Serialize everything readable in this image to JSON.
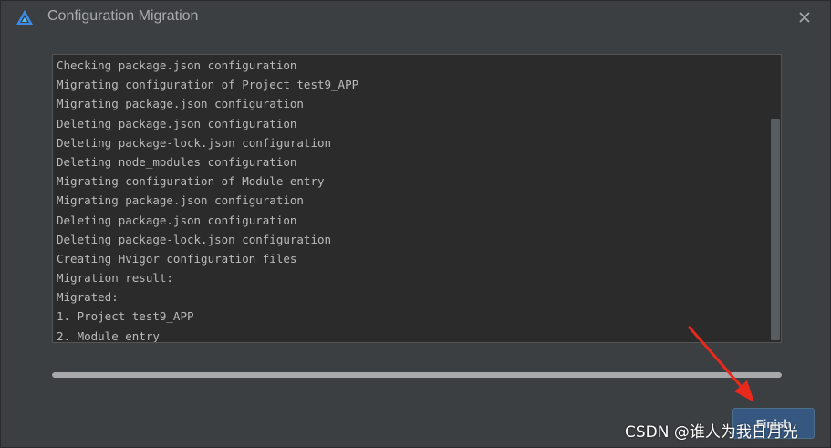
{
  "window": {
    "title": "Configuration Migration",
    "app_icon": "harmony-deveco-logo",
    "close_icon": "close-icon"
  },
  "log": {
    "lines": [
      "Checking package.json configuration",
      "Migrating configuration of Project test9_APP",
      "Migrating package.json configuration",
      "Deleting package.json configuration",
      "Deleting package-lock.json configuration",
      "Deleting node_modules configuration",
      "Migrating configuration of Module entry",
      "Migrating package.json configuration",
      "Deleting package.json configuration",
      "Deleting package-lock.json configuration",
      "Creating Hvigor configuration files",
      "Migration result:",
      "Migrated:",
      "1. Project test9_APP",
      "2. Module entry"
    ]
  },
  "progress": {
    "percent": 100
  },
  "footer": {
    "finish_label": "Finish"
  },
  "watermark": {
    "text": "CSDN @谁人为我日月光"
  },
  "colors": {
    "background": "#3c3f41",
    "log_background": "#2b2b2b",
    "button_primary": "#365880",
    "annotation_arrow": "#e8291c"
  }
}
